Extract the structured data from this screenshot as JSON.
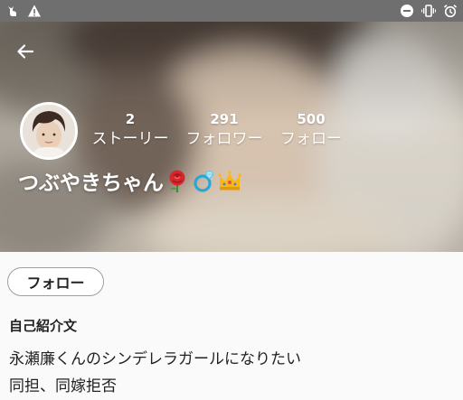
{
  "status_bar": {
    "left_icons": [
      "cat-notification-icon",
      "warning-icon"
    ],
    "right_icons": [
      "do-not-disturb-icon",
      "vibrate-icon",
      "alarm-icon"
    ]
  },
  "header": {
    "back_icon": "arrow-left-icon"
  },
  "stats": {
    "stories": {
      "count": "2",
      "label": "ストーリー"
    },
    "followers": {
      "count": "291",
      "label": "フォロワー"
    },
    "following": {
      "count": "500",
      "label": "フォロー"
    }
  },
  "profile": {
    "display_name": "つぶやきちゃん",
    "name_emojis": [
      "rose-emoji",
      "ring-emoji",
      "crown-emoji"
    ]
  },
  "actions": {
    "follow_label": "フォロー"
  },
  "bio": {
    "heading": "自己紹介文",
    "lines": [
      "永瀬廉くんのシンデレラガールになりたい",
      "同担、同嫁拒否"
    ]
  },
  "colors": {
    "status_bar": "#6f6f6f",
    "header_text": "#ffffff",
    "body_background": "#fafafa",
    "button_border": "#9e9e9e"
  }
}
